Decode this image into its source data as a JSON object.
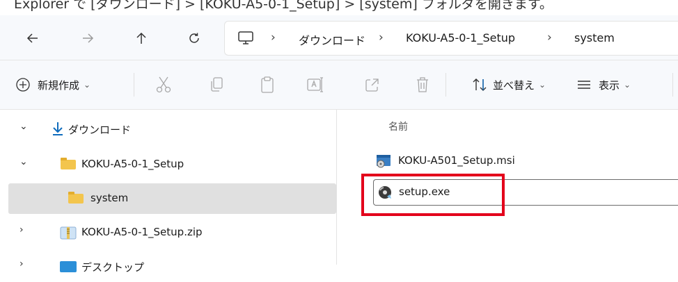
{
  "top_strip_text": "Explorer で [ダウンロード] > [KOKU-A5-0-1_Setup] > [system] フォルダを開きます。",
  "address_bar": {
    "back_icon": "arrow-left-icon",
    "forward_icon": "arrow-right-icon",
    "up_icon": "arrow-up-icon",
    "refresh_icon": "refresh-icon",
    "computer_icon": "monitor-icon",
    "breadcrumbs": [
      "ダウンロード",
      "KOKU-A5-0-1_Setup",
      "system"
    ],
    "separator": "›"
  },
  "toolbar": {
    "new_label": "新規作成",
    "new_chevron": "⌄",
    "sort_label": "並べ替え",
    "sort_chevron": "⌄",
    "view_label": "表示",
    "view_chevron": "⌄"
  },
  "nav_pane": {
    "items": [
      {
        "label": "ダウンロード",
        "expander": "⌄"
      },
      {
        "label": "KOKU-A5-0-1_Setup",
        "expander": "⌄"
      },
      {
        "label": "system"
      },
      {
        "label": "KOKU-A5-0-1_Setup.zip",
        "expander": "›"
      },
      {
        "label": "デスクトップ",
        "expander": "›"
      }
    ]
  },
  "file_pane": {
    "column_name": "名前",
    "files": [
      {
        "name": "KOKU-A501_Setup.msi",
        "icon": "msi-installer-icon"
      },
      {
        "name": "setup.exe",
        "icon": "setup-disc-icon"
      }
    ]
  },
  "colors": {
    "highlight_box": "#e3001b",
    "selected_row": "#e0e0e0",
    "download_arrow": "#0f6cbd",
    "folder": "#f3c54d"
  }
}
